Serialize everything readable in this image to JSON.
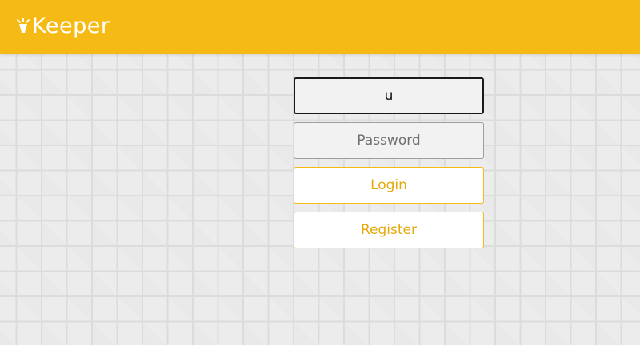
{
  "header": {
    "brand_name": "Keeper",
    "brand_icon": "lamp-icon",
    "background_color": "#f5ba14"
  },
  "login_form": {
    "username_value": "u",
    "password_placeholder": "Password",
    "login_label": "Login",
    "register_label": "Register",
    "accent_color": "#f5ba14"
  }
}
